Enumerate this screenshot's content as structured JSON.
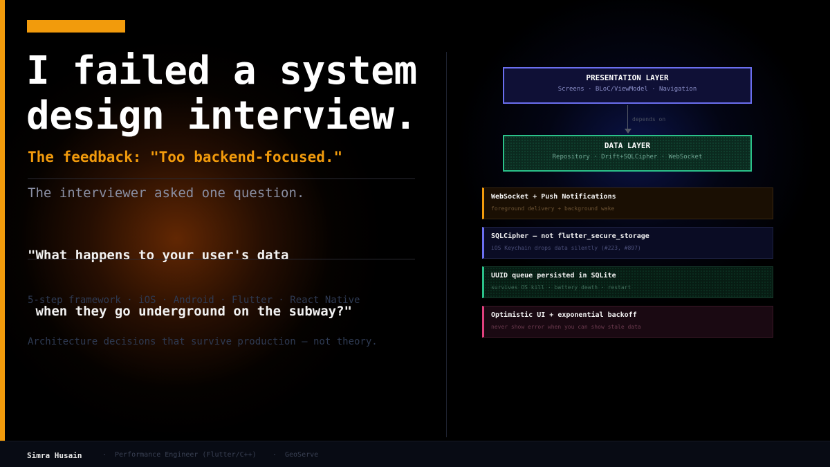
{
  "headline": {
    "line1": "I failed a system",
    "line2": "design interview."
  },
  "feedback": "The feedback: \"Too backend-focused.\"",
  "asked": "The interviewer asked one question.",
  "quote": {
    "line1": "\"What happens to your user's data",
    "line2": " when they go underground on the subway?\""
  },
  "meta": {
    "line1": "5-step framework · iOS · Android · Flutter · React Native",
    "line2": "Architecture decisions that survive production — not theory."
  },
  "diagram": {
    "presentation": {
      "title": "PRESENTATION LAYER",
      "subtitle": "Screens · BLoC/ViewModel · Navigation"
    },
    "arrow_label": "depends on",
    "data": {
      "title": "DATA LAYER",
      "subtitle": "Repository · Drift+SQLCipher · WebSocket"
    },
    "cards": [
      {
        "title": "WebSocket + Push Notifications",
        "subtitle": "foreground delivery + background wake",
        "color": "#f29b0c"
      },
      {
        "title": "SQLCipher — not flutter_secure_storage",
        "subtitle": "iOS Keychain drops data silently (#223, #897)",
        "color": "#6b6ff0"
      },
      {
        "title": "UUID queue persisted in SQLite",
        "subtitle": "survives OS kill · battery death · restart",
        "color": "#2bc28a"
      },
      {
        "title": "Optimistic UI + exponential backoff",
        "subtitle": "never show error when you can show stale data",
        "color": "#e0407d"
      }
    ]
  },
  "footer": {
    "name": "Simra Husain",
    "separator": "·",
    "role": "Performance Engineer (Flutter/C++)",
    "company": "GeoServe"
  },
  "colors": {
    "accent": "#f29b0c",
    "presentation": "#6b6ff0",
    "data": "#2bc28a"
  }
}
